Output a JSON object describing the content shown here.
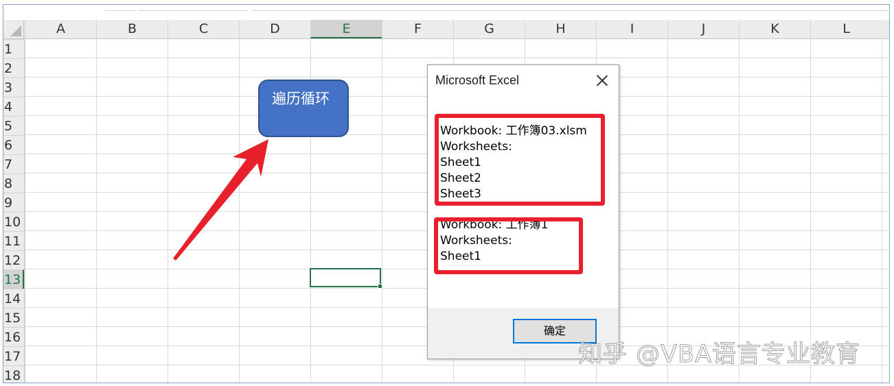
{
  "spreadsheet": {
    "columns": [
      "A",
      "B",
      "C",
      "D",
      "E",
      "F",
      "G",
      "H",
      "I",
      "J",
      "K",
      "L"
    ],
    "rows": [
      "1",
      "2",
      "3",
      "4",
      "5",
      "6",
      "7",
      "8",
      "9",
      "10",
      "11",
      "12",
      "13",
      "14",
      "15",
      "16",
      "17",
      "18"
    ],
    "active_column": "E",
    "active_row": "13",
    "gridline_color": "#dadada",
    "selection_color": "#217346"
  },
  "shape": {
    "label": "遍历循环",
    "fill_color": "#4472c4"
  },
  "annotation": {
    "arrow_color": "#e8202b",
    "highlight_color": "#e8202b"
  },
  "dialog": {
    "title": "Microsoft Excel",
    "close_icon": "close-icon",
    "block1": {
      "workbook": "Workbook: 工作簿03.xlsm",
      "worksheets_label": "Worksheets:",
      "sheets": [
        "Sheet1",
        "Sheet2",
        "Sheet3"
      ]
    },
    "block2": {
      "workbook": "Workbook: 工作簿1",
      "worksheets_label": "Worksheets:",
      "sheets": [
        "Sheet1"
      ]
    },
    "ok_label": "确定"
  },
  "watermark": "知乎 @VBA语言专业教育"
}
